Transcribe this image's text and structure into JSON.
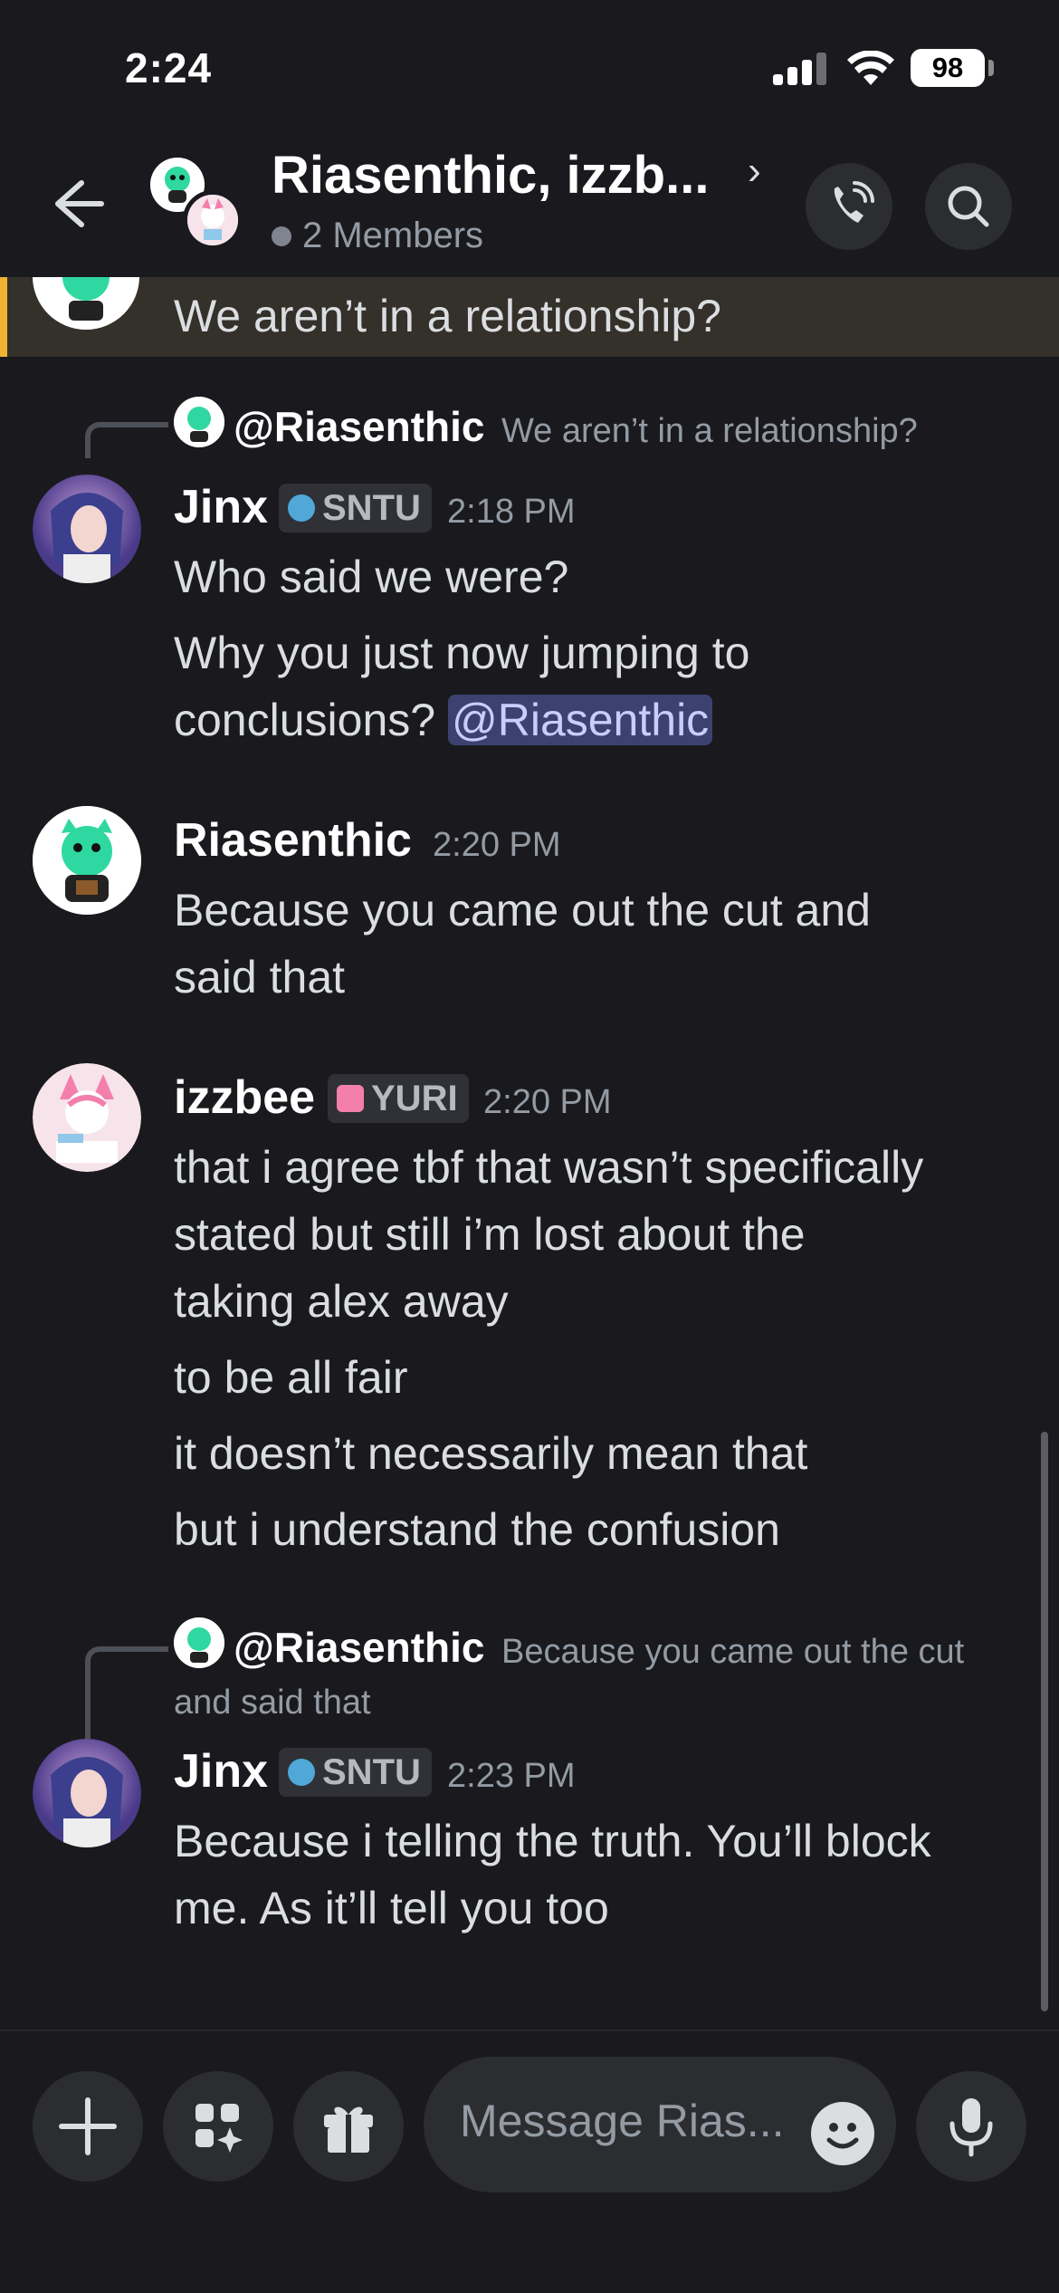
{
  "status_bar": {
    "time": "2:24",
    "battery": "98"
  },
  "header": {
    "title": "Riasenthic, izzb...",
    "members": "2 Members"
  },
  "highlighted": {
    "text": "We aren’t in a relationship?"
  },
  "messages": [
    {
      "reply_user": "@Riasenthic",
      "reply_snippet": "We aren’t in a relationship?",
      "user": "Jinx",
      "tag": "SNTU",
      "time": "2:18 PM",
      "lines": [
        "Who said we were?",
        "Why you just now jumping to",
        "conclusions?"
      ],
      "mention": "@Riasenthic"
    },
    {
      "user": "Riasenthic",
      "time": "2:20 PM",
      "lines": [
        "Because you came out the cut and",
        "said that"
      ]
    },
    {
      "user": "izzbee",
      "tag": "YURI",
      "time": "2:20 PM",
      "lines": [
        "that i agree tbf that wasn’t specifically",
        "stated but still i’m lost about the",
        "taking alex away",
        "to be all fair",
        "it doesn’t necessarily mean that",
        "but i understand the confusion"
      ]
    },
    {
      "reply_user": "@Riasenthic",
      "reply_snippet_1": "Because you came out the cut",
      "reply_snippet_2": "and said that",
      "user": "Jinx",
      "tag": "SNTU",
      "time": "2:23 PM",
      "lines": [
        "Because i telling the truth. You’ll block",
        "me. As it’ll tell you too"
      ]
    }
  ],
  "composer": {
    "placeholder": "Message Rias..."
  },
  "colors": {
    "background": "#1a1a1e",
    "highlight_bar": "#f0b232",
    "mention_bg": "#3c4270",
    "sntu_tag": "#4fa8d8",
    "yuri_tag": "#f47fab"
  }
}
